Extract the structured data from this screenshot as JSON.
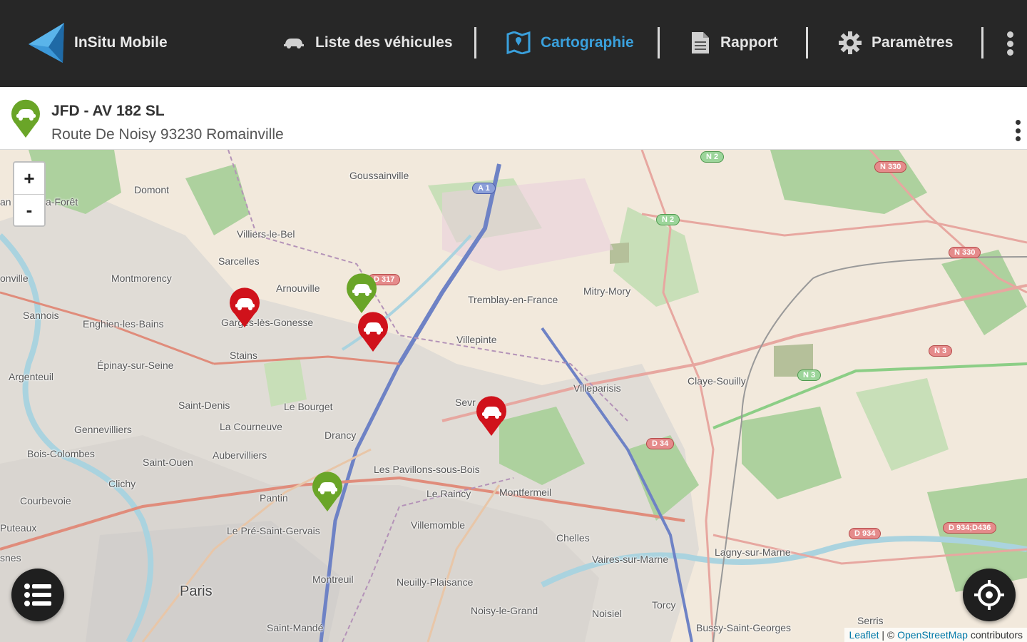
{
  "app": {
    "name": "InSitu Mobile"
  },
  "nav": {
    "items": [
      {
        "id": "vehicles",
        "label": "Liste des véhicules",
        "icon": "car-icon",
        "active": false
      },
      {
        "id": "map",
        "label": "Cartographie",
        "icon": "map-icon",
        "active": true
      },
      {
        "id": "report",
        "label": "Rapport",
        "icon": "document-icon",
        "active": false
      },
      {
        "id": "settings",
        "label": "Paramètres",
        "icon": "gear-icon",
        "active": false
      }
    ]
  },
  "vehicle": {
    "title": "JFD - AV 182 SL",
    "address": "Route De Noisy 93230 Romainville",
    "status_color": "#6aa528"
  },
  "map": {
    "zoom_in": "+",
    "zoom_out": "-",
    "places": {
      "goussainville": "Goussainville",
      "domont": "Domont",
      "foret": "a-Forêt",
      "an": "an",
      "villiers": "Villiers-le-Bel",
      "sarcelles": "Sarcelles",
      "montmorency": "Montmorency",
      "arnouville": "Arnouville",
      "garges": "Garges-lès-Gonesse",
      "onville": "onville",
      "sannois": "Sannois",
      "enghien": "Enghien-les-Bains",
      "stains": "Stains",
      "argenteuil": "Argenteuil",
      "epinay": "Épinay-sur-Seine",
      "saintdenis": "Saint-Denis",
      "bourget": "Le Bourget",
      "courneuve": "La Courneuve",
      "drancy": "Drancy",
      "gennevilliers": "Gennevilliers",
      "boiscolombes": "Bois-Colombes",
      "saintouen": "Saint-Ouen",
      "aubervilliers": "Aubervilliers",
      "clichy": "Clichy",
      "pavillons": "Les Pavillons-sous-Bois",
      "courbevoie": "Courbevoie",
      "pantin": "Pantin",
      "raincy": "Le Raincy",
      "montfermeil": "Montfermeil",
      "puteaux": "Puteaux",
      "preSaintGervais": "Le Pré-Saint-Gervais",
      "villemomble": "Villemomble",
      "tremblay": "Tremblay-en-France",
      "mitry": "Mitry-Mory",
      "villepinte": "Villepinte",
      "sevran": "Sevr",
      "villeparisis": "Villeparisis",
      "claye": "Claye-Souilly",
      "chelles": "Chelles",
      "vaires": "Vaires-sur-Marne",
      "lagny": "Lagny-sur-Marne",
      "montreuil": "Montreuil",
      "neuilly": "Neuilly-Plaisance",
      "paris": "Paris",
      "noisygrand": "Noisy-le-Grand",
      "noisiel": "Noisiel",
      "torcy": "Torcy",
      "serris": "Serris",
      "bussy": "Bussy-Saint-Georges",
      "saintmande": "Saint-Mandé",
      "snes": "snes"
    },
    "shields": {
      "n2a": "N 2",
      "n330a": "N 330",
      "a1": "A 1",
      "n2b": "N 2",
      "d317": "D 317",
      "n330b": "N 330",
      "n3a": "N 3",
      "n3b": "N 3",
      "d34": "D 34",
      "d934": "D 934",
      "d934d436": "D 934;D436"
    },
    "attribution": {
      "leaflet": "Leaflet",
      "sep": " | © ",
      "osm": "OpenStreetMap",
      "contrib": " contributors"
    },
    "marker_colors": {
      "moving": "#6aa528",
      "stopped": "#d0121b"
    }
  }
}
